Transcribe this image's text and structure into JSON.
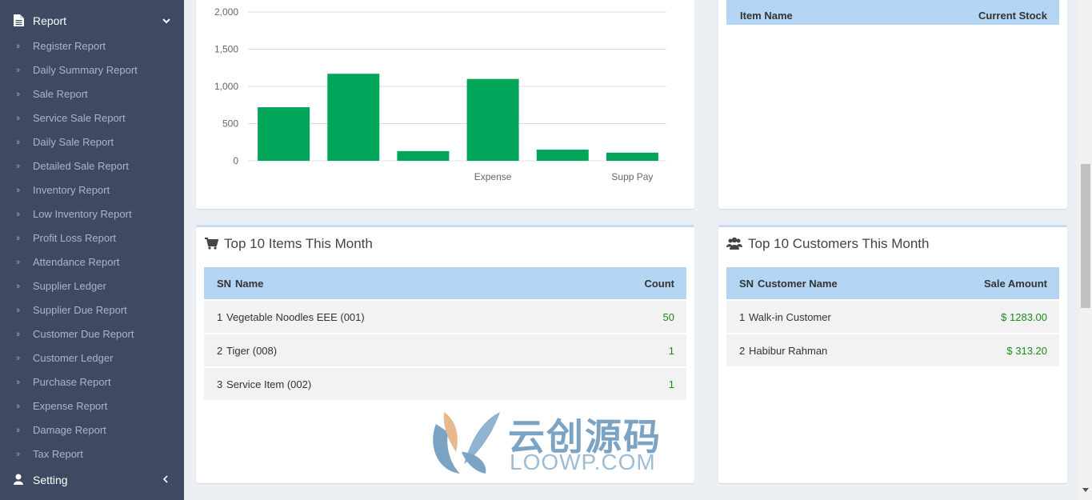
{
  "sidebar": {
    "header": {
      "label": "Report"
    },
    "items": [
      {
        "label": "Register Report"
      },
      {
        "label": "Daily Summary Report"
      },
      {
        "label": "Sale Report"
      },
      {
        "label": "Service Sale Report"
      },
      {
        "label": "Daily Sale Report"
      },
      {
        "label": "Detailed Sale Report"
      },
      {
        "label": "Inventory Report"
      },
      {
        "label": "Low Inventory Report"
      },
      {
        "label": "Profit Loss Report"
      },
      {
        "label": "Attendance Report"
      },
      {
        "label": "Supplier Ledger"
      },
      {
        "label": "Supplier Due Report"
      },
      {
        "label": "Customer Due Report"
      },
      {
        "label": "Customer Ledger"
      },
      {
        "label": "Purchase Report"
      },
      {
        "label": "Expense Report"
      },
      {
        "label": "Damage Report"
      },
      {
        "label": "Tax Report"
      }
    ],
    "setting": {
      "label": "Setting"
    }
  },
  "chart_data": {
    "type": "bar",
    "categories": [
      "",
      "",
      "",
      "Expense",
      "",
      "Supp Pay"
    ],
    "values": [
      720,
      1170,
      130,
      1100,
      150,
      110
    ],
    "ylim": [
      0,
      2000
    ],
    "yticks": [
      "0",
      "500",
      "1,000",
      "1,500",
      "2,000"
    ],
    "bar_color": "#02a65a",
    "grid": true
  },
  "stock_table": {
    "headers": {
      "name": "Item Name",
      "value": "Current Stock"
    }
  },
  "top_items": {
    "title": "Top 10 Items This Month",
    "headers": {
      "sn": "SN",
      "name": "Name",
      "value": "Count"
    },
    "rows": [
      {
        "sn": "1",
        "name": "Vegetable Noodles EEE (001)",
        "value": "50"
      },
      {
        "sn": "2",
        "name": "Tiger (008)",
        "value": "1"
      },
      {
        "sn": "3",
        "name": "Service Item (002)",
        "value": "1"
      }
    ]
  },
  "top_customers": {
    "title": "Top 10 Customers This Month",
    "headers": {
      "sn": "SN",
      "name": "Customer Name",
      "value": "Sale Amount"
    },
    "rows": [
      {
        "sn": "1",
        "name": "Walk-in Customer",
        "value": "$ 1283.00"
      },
      {
        "sn": "2",
        "name": "Habibur Rahman",
        "value": "$ 313.20"
      }
    ]
  },
  "watermark": {
    "cn": "云创源码",
    "en": "LOOWP.COM"
  }
}
